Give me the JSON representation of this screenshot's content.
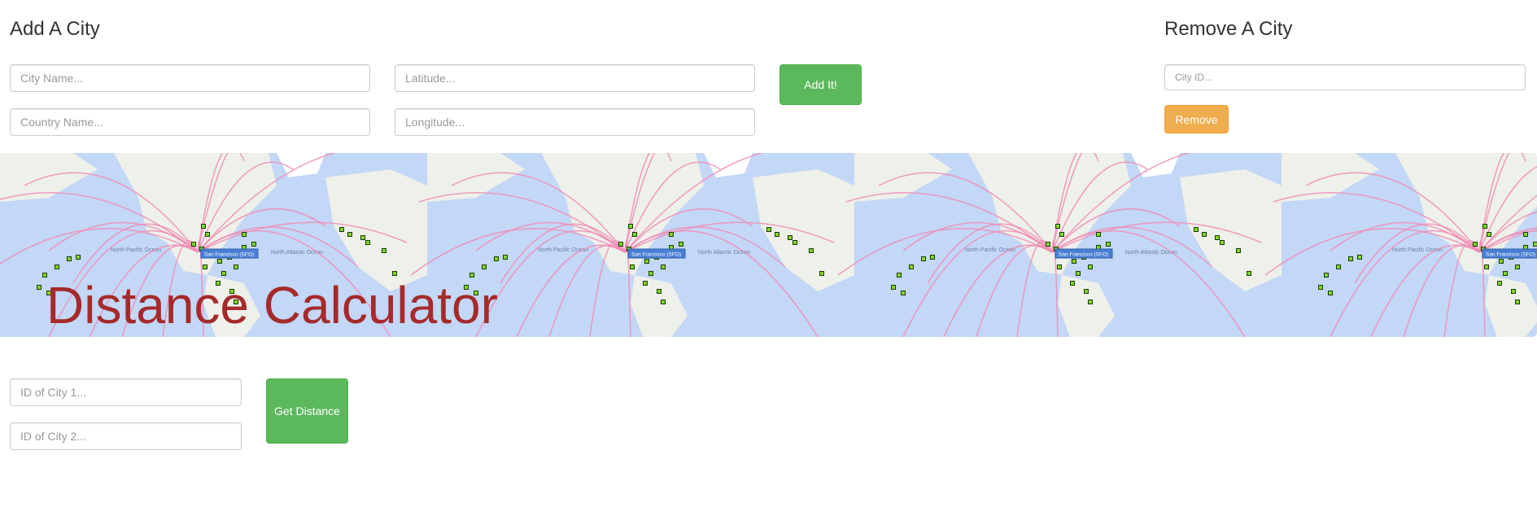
{
  "add_city": {
    "heading": "Add A City",
    "city_name_placeholder": "City Name...",
    "country_name_placeholder": "Country Name...",
    "latitude_placeholder": "Latitude...",
    "longitude_placeholder": "Longitude...",
    "submit_label": "Add It!"
  },
  "remove_city": {
    "heading": "Remove A City",
    "city_id_placeholder": "City ID...",
    "submit_label": "Remove"
  },
  "banner": {
    "title": "Distance Calculator",
    "map_labels": [
      "North Pacific Ocean",
      "North Atlantic Ocean"
    ],
    "marker_label": "San Francisco (SFO)"
  },
  "distance": {
    "city1_placeholder": "ID of City 1...",
    "city2_placeholder": "ID of City 2...",
    "submit_label": "Get Distance"
  },
  "colors": {
    "ocean": "#c3d7f6",
    "land": "#eef0ea",
    "routes": "#f08cb4",
    "markers": "#7fd62b",
    "title": "#a52a2a",
    "success": "#5cb85c",
    "warning": "#f0ad4e"
  }
}
